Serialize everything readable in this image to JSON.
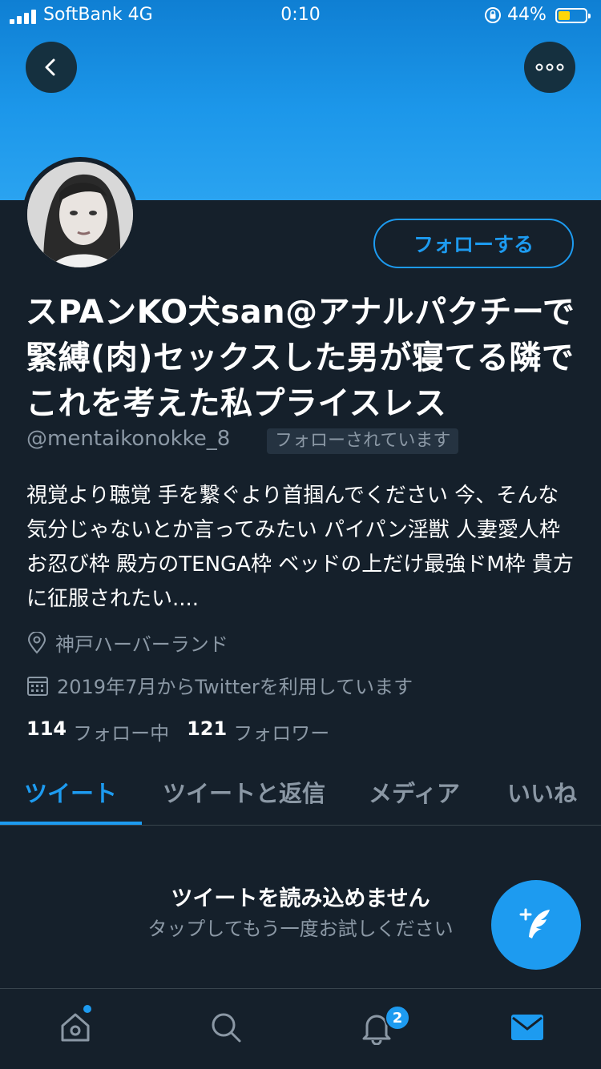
{
  "status_bar": {
    "carrier": "SoftBank 4G",
    "time": "0:10",
    "battery_percent": "44%",
    "battery_level": 0.44
  },
  "profile": {
    "follow_button_label": "フォローする",
    "display_name": "スPAンKO犬san@アナルパクチーで緊縛(肉)セックスした男が寝てる隣でこれを考えた私プライスレス",
    "handle": "@mentaikonokke_8",
    "follows_you_label": "フォローされています",
    "bio": "視覚より聴覚 手を繋ぐより首掴んでください 今、そんな気分じゃないとか言ってみたい パイパン淫獣 人妻愛人枠 お忍び枠 殿方のTENGA枠 ベッドの上だけ最強ドM枠 貴方に征服されたい....",
    "location": "神戸ハーバーランド",
    "joined": "2019年7月からTwitterを利用しています",
    "following_count": "114",
    "following_label": "フォロー中",
    "followers_count": "121",
    "followers_label": "フォロワー"
  },
  "tabs": [
    {
      "label": "ツイート",
      "active": true
    },
    {
      "label": "ツイートと返信",
      "active": false
    },
    {
      "label": "メディア",
      "active": false
    },
    {
      "label": "いいね",
      "active": false
    }
  ],
  "empty_state": {
    "title": "ツイートを読み込めません",
    "subtitle": "タップしてもう一度お試しください"
  },
  "bottom_nav": {
    "items": [
      "home-icon",
      "search-icon",
      "notifications-icon",
      "messages-icon"
    ],
    "notification_badge": "2"
  },
  "colors": {
    "accent": "#1d9bf0",
    "background": "#15202b",
    "secondary_text": "#8b98a5"
  }
}
